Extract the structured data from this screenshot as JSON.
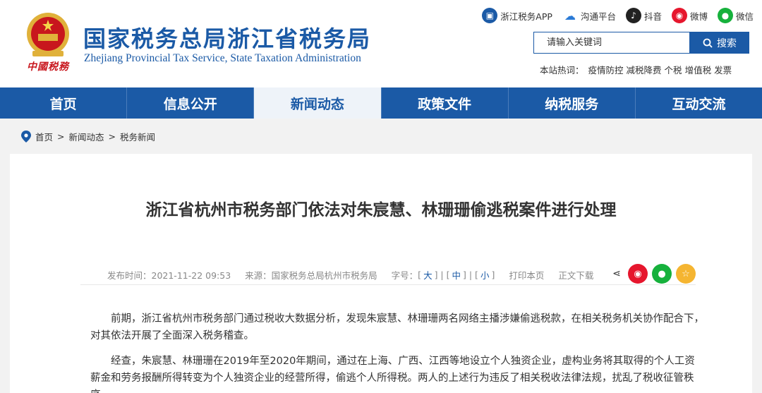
{
  "header": {
    "title": "国家税务总局浙江省税务局",
    "subtitle": "Zhejiang Provincial Tax Service, State Taxation Administration",
    "slogan": "中國税務",
    "social": [
      {
        "label": "浙江税务APP",
        "icon": "app-icon",
        "color": "#1b5aa6"
      },
      {
        "label": "沟通平台",
        "icon": "cloud-icon",
        "color": "#2a7ad6"
      },
      {
        "label": "抖音",
        "icon": "douyin-icon",
        "color": "#222222"
      },
      {
        "label": "微博",
        "icon": "weibo-icon",
        "color": "#e6162d"
      },
      {
        "label": "微信",
        "icon": "wechat-icon",
        "color": "#16b13c"
      }
    ],
    "search": {
      "placeholder": "请输入关键词",
      "button": "搜索"
    },
    "hot": {
      "label": "本站热词：",
      "words": [
        "疫情防控",
        "减税降费",
        "个税",
        "增值税",
        "发票"
      ]
    }
  },
  "nav": {
    "items": [
      "首页",
      "信息公开",
      "新闻动态",
      "政策文件",
      "纳税服务",
      "互动交流"
    ],
    "active_index": 2
  },
  "breadcrumb": [
    "首页",
    "新闻动态",
    "税务新闻"
  ],
  "article": {
    "title": "浙江省杭州市税务部门依法对朱宸慧、林珊珊偷逃税案件进行处理",
    "meta": {
      "date": "发布时间：2021-11-22  09:53",
      "source": "来源：国家税务总局杭州市税务局",
      "size_label": "字号：",
      "sizes": [
        "大",
        "中",
        "小"
      ],
      "print": "打印本页",
      "download": "正文下载"
    },
    "share_icons": [
      "share-icon",
      "weibo-icon",
      "wechat-icon",
      "favorite-icon"
    ],
    "paragraphs": [
      "前期，浙江省杭州市税务部门通过税收大数据分析，发现朱宸慧、林珊珊两名网络主播涉嫌偷逃税款，在相关税务机关协作配合下，对其依法开展了全面深入税务稽查。",
      "经查，朱宸慧、林珊珊在2019年至2020年期间，通过在上海、广西、江西等地设立个人独资企业，虚构业务将其取得的个人工资薪金和劳务报酬所得转变为个人独资企业的经营所得，偷逃个人所得税。两人的上述行为违反了相关税收法律法规，扰乱了税收征管秩序。"
    ]
  },
  "colors": {
    "brand_blue": "#1b5aa6",
    "red": "#c8161d",
    "weibo_red": "#e6162d",
    "wechat_green": "#16b13c",
    "star_yellow": "#f5b531"
  }
}
